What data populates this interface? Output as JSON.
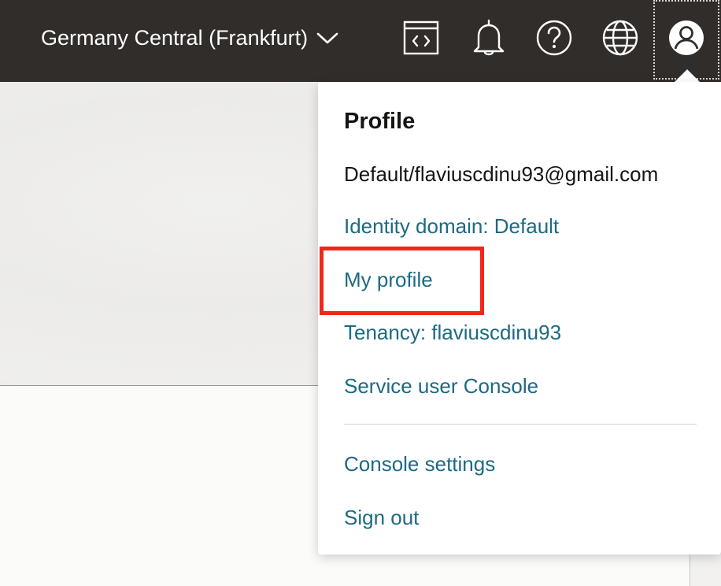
{
  "header": {
    "region_label": "Germany Central (Frankfurt)",
    "icons": {
      "region_dropdown": "chevron-down-icon",
      "developer_tools": "code-editor-icon",
      "notifications": "bell-icon",
      "help": "help-icon",
      "language": "globe-icon",
      "profile": "user-avatar-icon"
    }
  },
  "profile_menu": {
    "title": "Profile",
    "user": "Default/flaviuscdinu93@gmail.com",
    "identity_domain": "Identity domain: Default",
    "my_profile": "My profile",
    "tenancy": "Tenancy: flaviuscdinu93",
    "service_user_console": "Service user Console",
    "console_settings": "Console settings",
    "sign_out": "Sign out"
  },
  "colors": {
    "header_bg": "#312d2a",
    "link": "#1d6a82",
    "highlight": "#f2261b"
  }
}
